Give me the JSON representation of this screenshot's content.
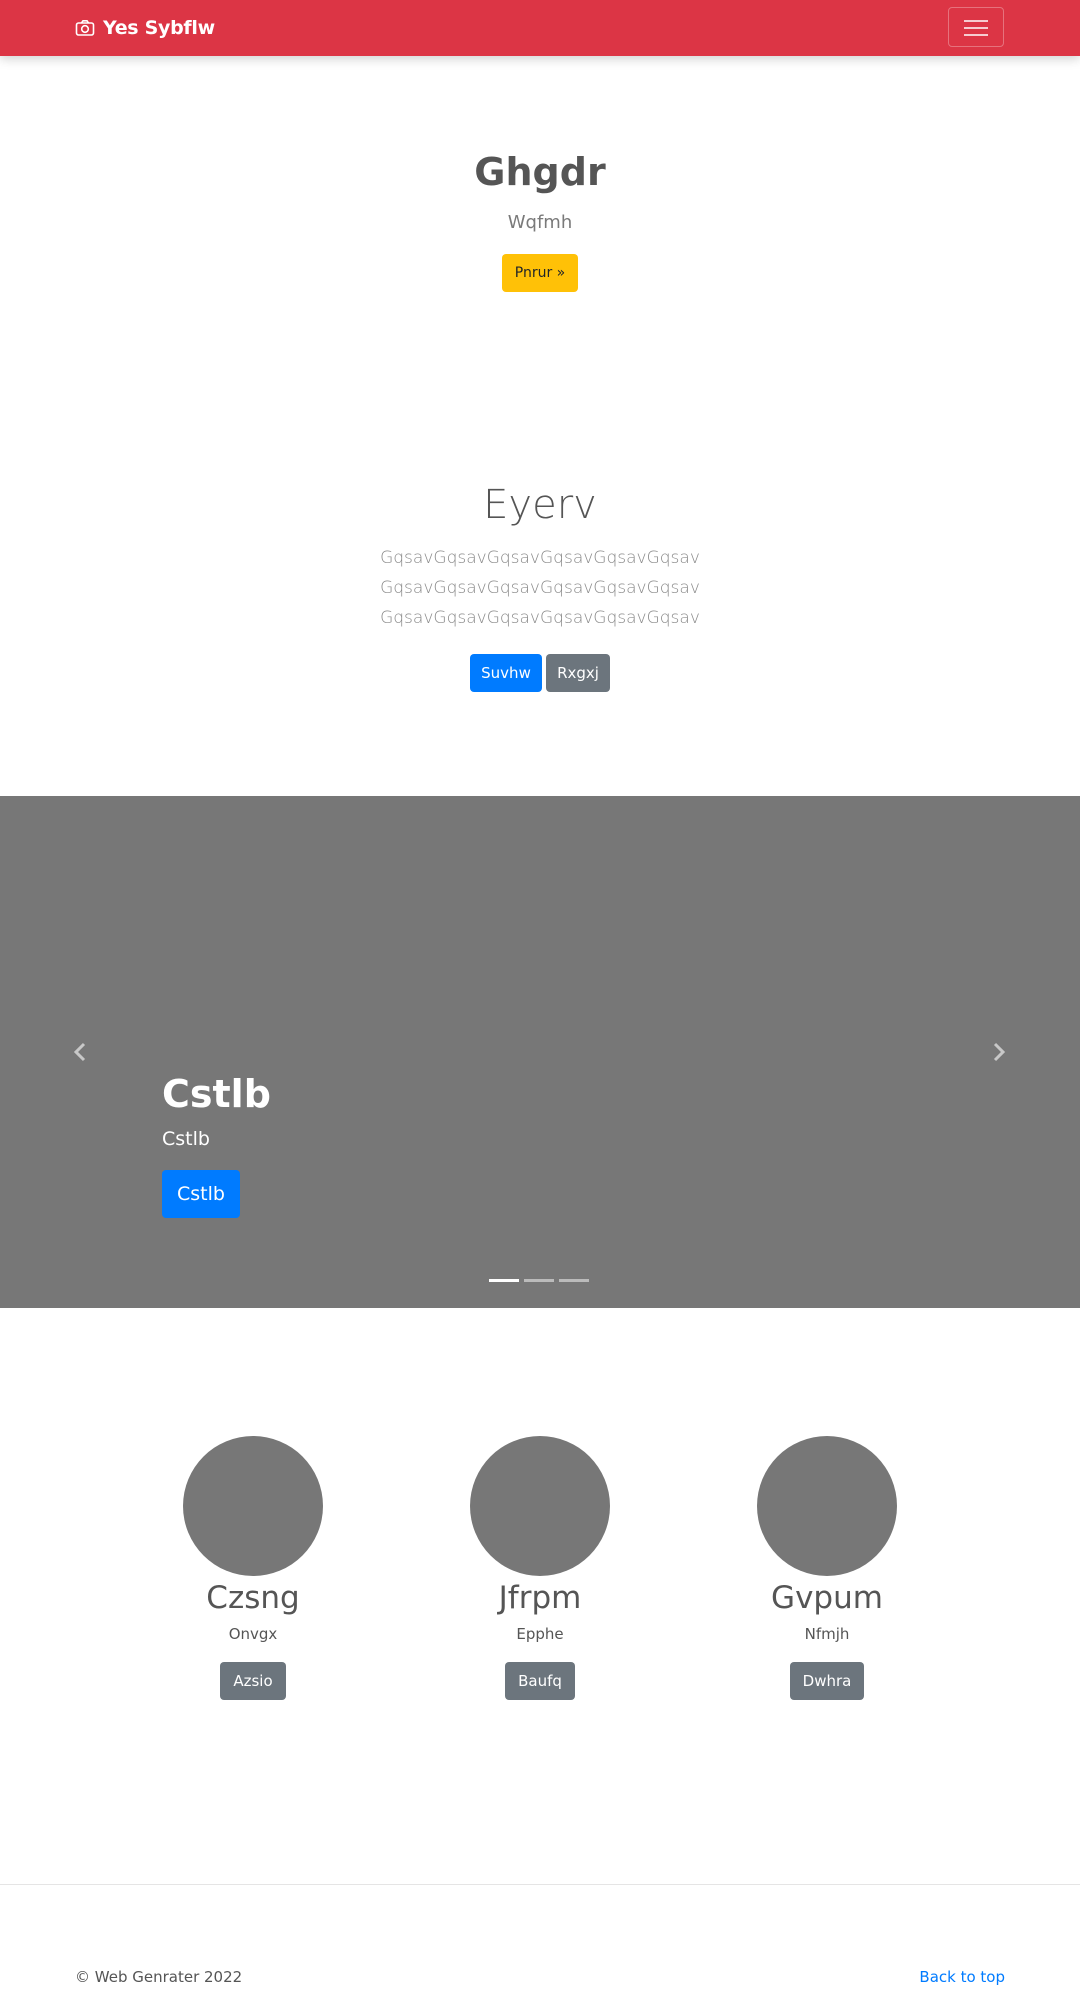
{
  "navbar": {
    "brand": "Yes Sybflw",
    "brand_icon": "camera-icon",
    "toggler_icon": "hamburger-menu-icon",
    "color": "#dc3545"
  },
  "hero": {
    "title": "Ghgdr",
    "subtitle": "Wqfmh",
    "button": "Pnrur »",
    "button_color": "#ffc107"
  },
  "section2": {
    "title": "Eyerv",
    "lines": [
      "GqsavGqsavGqsavGqsavGqsavGqsav",
      "GqsavGqsavGqsavGqsavGqsavGqsav",
      "GqsavGqsavGqsavGqsavGqsavGqsav"
    ],
    "primary_button": "Suvhw",
    "secondary_button": "Rxgxj"
  },
  "carousel": {
    "title": "Cstlb",
    "text": "Cstlb",
    "button": "Cstlb",
    "prev_icon": "chevron-left-icon",
    "next_icon": "chevron-right-icon",
    "indicator_count": 3,
    "active_index": 0
  },
  "features": [
    {
      "title": "Czsng",
      "subtitle": "Onvgx",
      "button": "Azsio"
    },
    {
      "title": "Jfrpm",
      "subtitle": "Epphe",
      "button": "Baufq"
    },
    {
      "title": "Gvpum",
      "subtitle": "Nfmjh",
      "button": "Dwhra"
    }
  ],
  "footer": {
    "copyright": "© Web Genrater 2022",
    "back_to_top": "Back to top"
  }
}
